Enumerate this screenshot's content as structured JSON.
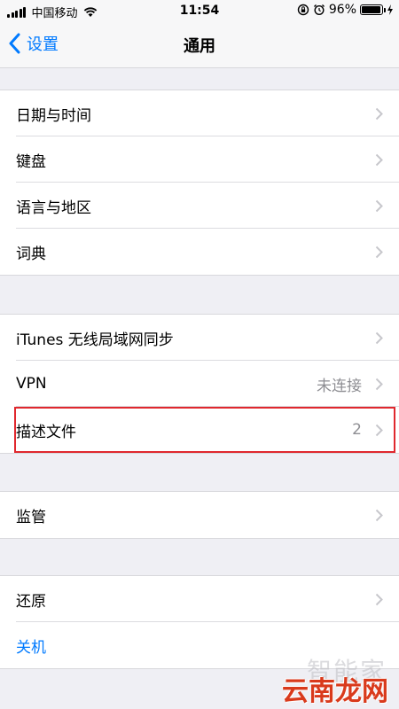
{
  "status_bar": {
    "carrier": "中国移动",
    "time": "11:54",
    "battery_percent": "96%",
    "battery_level": 0.96
  },
  "nav": {
    "back_label": "设置",
    "title": "通用"
  },
  "groups": [
    {
      "items": [
        {
          "label": "日期与时间"
        },
        {
          "label": "键盘"
        },
        {
          "label": "语言与地区"
        },
        {
          "label": "词典"
        }
      ]
    },
    {
      "items": [
        {
          "label": "iTunes 无线局域网同步"
        },
        {
          "label": "VPN",
          "value": "未连接"
        },
        {
          "label": "描述文件",
          "value": "2"
        }
      ]
    },
    {
      "items": [
        {
          "label": "监管"
        }
      ]
    },
    {
      "items": [
        {
          "label": "还原"
        },
        {
          "label": "关机"
        }
      ]
    }
  ],
  "watermark": {
    "faint": "智能家",
    "main": "云南龙网"
  },
  "colors": {
    "accent": "#007aff",
    "highlight": "#e0282e",
    "background": "#efeff4"
  }
}
